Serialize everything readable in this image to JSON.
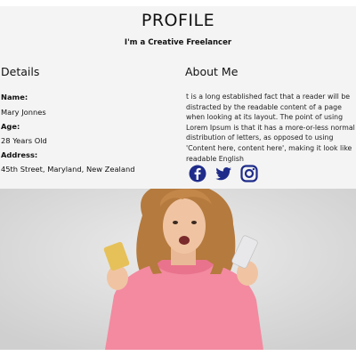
{
  "header": {
    "title": "PROFILE",
    "subtitle": "I'm a Creative Freelancer"
  },
  "details": {
    "heading": "Details",
    "fields": [
      {
        "label": "Name:",
        "value": "Mary Jonnes"
      },
      {
        "label": "Age:",
        "value": "28 Years Old"
      },
      {
        "label": "Address:",
        "value": "45th Street, Maryland, New Zealand"
      }
    ]
  },
  "about": {
    "heading": "About Me",
    "text": "t is a long established fact that a reader will be distracted by the readable content of a page when looking at its layout. The point of using Lorem Ipsum is that it has a more-or-less normal distribution of letters, as opposed to using 'Content here, content here', making it look like readable English"
  },
  "socials": [
    {
      "icon": "facebook-icon"
    },
    {
      "icon": "twitter-icon"
    },
    {
      "icon": "instagram-icon"
    }
  ],
  "colors": {
    "panel_bg": "#f4f4f4",
    "social_icon": "#1f2c8a",
    "photo_bg": "#dcdcdc",
    "hoodie": "#f38aa0"
  }
}
